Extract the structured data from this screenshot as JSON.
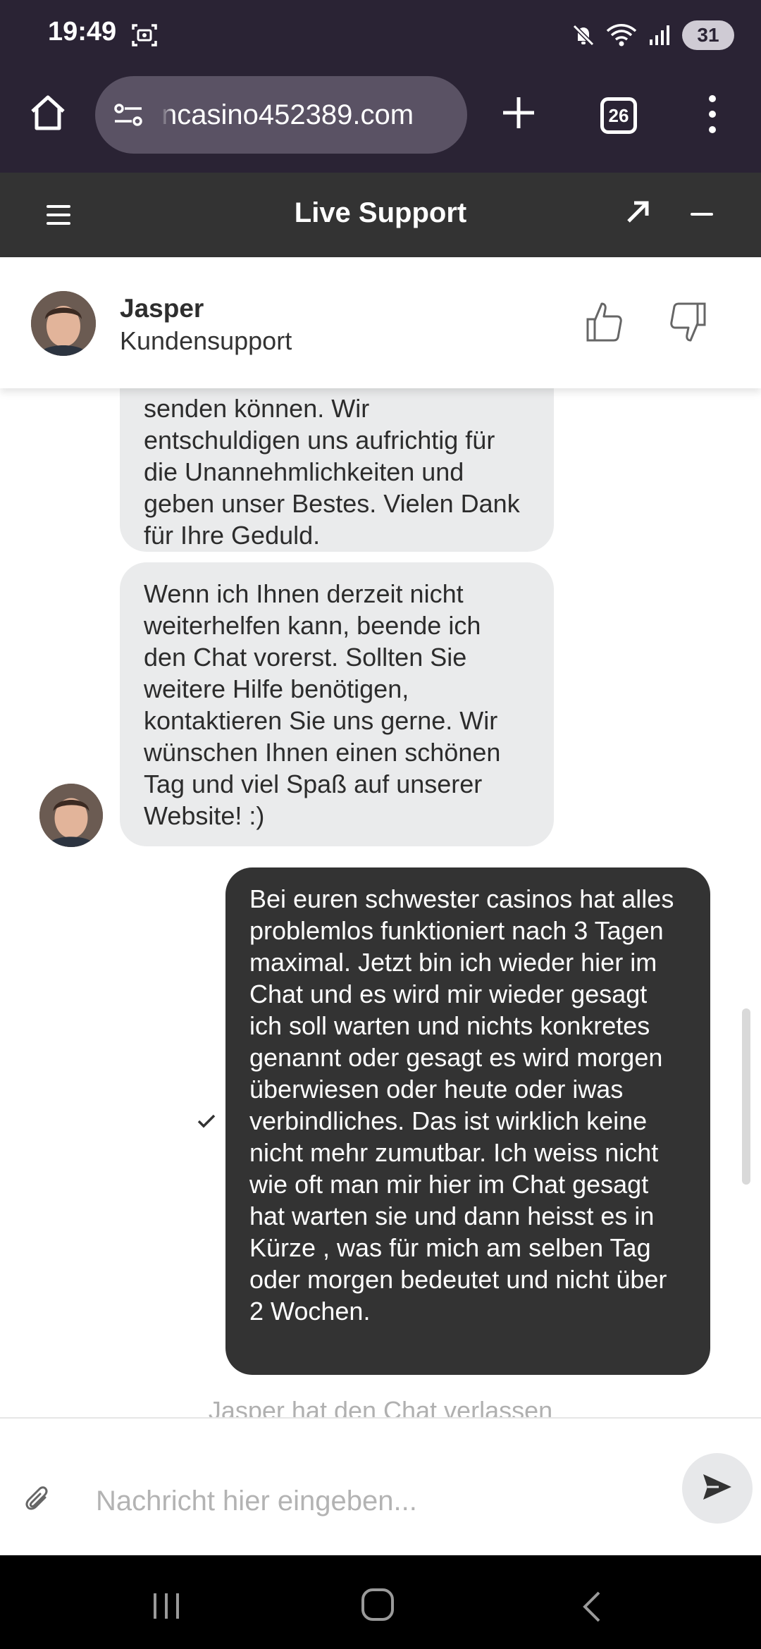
{
  "status_bar": {
    "time": "19:49",
    "battery": "31",
    "icons": [
      "screenshot-icon",
      "mute-icon",
      "wifi-icon",
      "signal-icon"
    ]
  },
  "browser": {
    "url": "ncasino452389.com",
    "tab_count": "26",
    "icons": [
      "home-icon",
      "site-settings-icon",
      "new-tab-icon",
      "more-icon"
    ]
  },
  "chat_header": {
    "title": "Live Support",
    "icons": [
      "menu-icon",
      "expand-icon",
      "minimize-icon"
    ]
  },
  "agent": {
    "name": "Jasper",
    "role": "Kundensupport",
    "icons": [
      "thumbs-up-icon",
      "thumbs-down-icon"
    ]
  },
  "messages": [
    {
      "sender": "agent",
      "text": "senden können. Wir entschuldigen uns aufrichtig für die Unannehmlichkeiten und geben unser Bestes. Vielen Dank für Ihre Geduld."
    },
    {
      "sender": "agent",
      "text": "Wenn ich Ihnen derzeit nicht weiterhelfen kann, beende ich den Chat vorerst. Sollten Sie weitere Hilfe benötigen, kontaktieren Sie uns gerne. Wir wünschen Ihnen einen schönen Tag und viel Spaß auf unserer Website! :)"
    },
    {
      "sender": "user",
      "text": "Bei euren schwester casinos hat alles problemlos funktioniert nach 3 Tagen maximal. Jetzt bin ich wieder hier im Chat und es wird mir wieder gesagt ich soll warten und nichts konkretes genannt oder gesagt es wird morgen überwiesen oder heute oder iwas verbindliches. Das ist wirklich keine nicht mehr zumutbar. Ich weiss nicht wie oft man mir hier im Chat gesagt hat warten sie und dann heisst es in Kürze , was für mich am selben Tag oder morgen bedeutet und nicht über 2 Wochen.",
      "status": "sent"
    }
  ],
  "system_note": "Jasper hat den Chat verlassen",
  "input": {
    "placeholder": "Nachricht hier eingeben...",
    "value": "",
    "icons": [
      "attach-icon",
      "send-icon"
    ]
  },
  "nav_bar": {
    "icons": [
      "recents-icon",
      "home-circle-icon",
      "back-icon"
    ]
  },
  "colors": {
    "browser_chrome": "#2a2334",
    "url_pill": "#5a5264",
    "chat_header": "#333333",
    "agent_bubble": "#eaebec",
    "user_bubble": "#333333",
    "send_button": "#e7e8ea"
  }
}
